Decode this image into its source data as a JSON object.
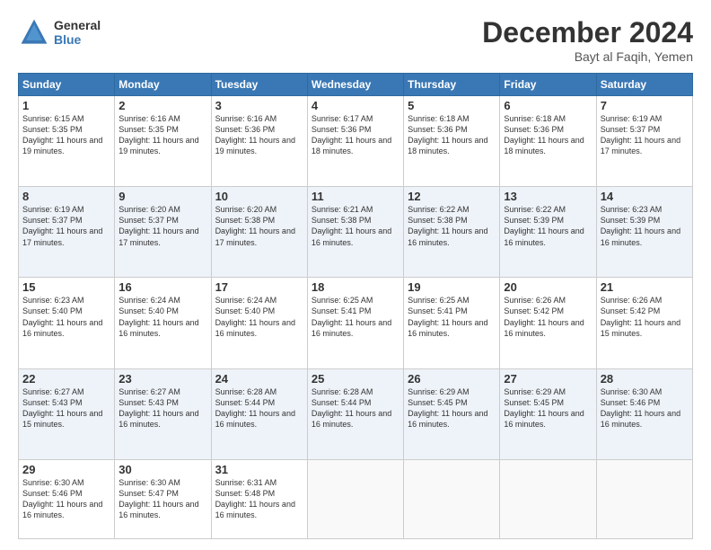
{
  "header": {
    "logo_line1": "General",
    "logo_line2": "Blue",
    "title": "December 2024",
    "subtitle": "Bayt al Faqih, Yemen"
  },
  "days_of_week": [
    "Sunday",
    "Monday",
    "Tuesday",
    "Wednesday",
    "Thursday",
    "Friday",
    "Saturday"
  ],
  "weeks": [
    [
      {
        "day": 1,
        "info": "Sunrise: 6:15 AM\nSunset: 5:35 PM\nDaylight: 11 hours and 19 minutes."
      },
      {
        "day": 2,
        "info": "Sunrise: 6:16 AM\nSunset: 5:35 PM\nDaylight: 11 hours and 19 minutes."
      },
      {
        "day": 3,
        "info": "Sunrise: 6:16 AM\nSunset: 5:36 PM\nDaylight: 11 hours and 19 minutes."
      },
      {
        "day": 4,
        "info": "Sunrise: 6:17 AM\nSunset: 5:36 PM\nDaylight: 11 hours and 18 minutes."
      },
      {
        "day": 5,
        "info": "Sunrise: 6:18 AM\nSunset: 5:36 PM\nDaylight: 11 hours and 18 minutes."
      },
      {
        "day": 6,
        "info": "Sunrise: 6:18 AM\nSunset: 5:36 PM\nDaylight: 11 hours and 18 minutes."
      },
      {
        "day": 7,
        "info": "Sunrise: 6:19 AM\nSunset: 5:37 PM\nDaylight: 11 hours and 17 minutes."
      }
    ],
    [
      {
        "day": 8,
        "info": "Sunrise: 6:19 AM\nSunset: 5:37 PM\nDaylight: 11 hours and 17 minutes."
      },
      {
        "day": 9,
        "info": "Sunrise: 6:20 AM\nSunset: 5:37 PM\nDaylight: 11 hours and 17 minutes."
      },
      {
        "day": 10,
        "info": "Sunrise: 6:20 AM\nSunset: 5:38 PM\nDaylight: 11 hours and 17 minutes."
      },
      {
        "day": 11,
        "info": "Sunrise: 6:21 AM\nSunset: 5:38 PM\nDaylight: 11 hours and 16 minutes."
      },
      {
        "day": 12,
        "info": "Sunrise: 6:22 AM\nSunset: 5:38 PM\nDaylight: 11 hours and 16 minutes."
      },
      {
        "day": 13,
        "info": "Sunrise: 6:22 AM\nSunset: 5:39 PM\nDaylight: 11 hours and 16 minutes."
      },
      {
        "day": 14,
        "info": "Sunrise: 6:23 AM\nSunset: 5:39 PM\nDaylight: 11 hours and 16 minutes."
      }
    ],
    [
      {
        "day": 15,
        "info": "Sunrise: 6:23 AM\nSunset: 5:40 PM\nDaylight: 11 hours and 16 minutes."
      },
      {
        "day": 16,
        "info": "Sunrise: 6:24 AM\nSunset: 5:40 PM\nDaylight: 11 hours and 16 minutes."
      },
      {
        "day": 17,
        "info": "Sunrise: 6:24 AM\nSunset: 5:40 PM\nDaylight: 11 hours and 16 minutes."
      },
      {
        "day": 18,
        "info": "Sunrise: 6:25 AM\nSunset: 5:41 PM\nDaylight: 11 hours and 16 minutes."
      },
      {
        "day": 19,
        "info": "Sunrise: 6:25 AM\nSunset: 5:41 PM\nDaylight: 11 hours and 16 minutes."
      },
      {
        "day": 20,
        "info": "Sunrise: 6:26 AM\nSunset: 5:42 PM\nDaylight: 11 hours and 16 minutes."
      },
      {
        "day": 21,
        "info": "Sunrise: 6:26 AM\nSunset: 5:42 PM\nDaylight: 11 hours and 15 minutes."
      }
    ],
    [
      {
        "day": 22,
        "info": "Sunrise: 6:27 AM\nSunset: 5:43 PM\nDaylight: 11 hours and 15 minutes."
      },
      {
        "day": 23,
        "info": "Sunrise: 6:27 AM\nSunset: 5:43 PM\nDaylight: 11 hours and 16 minutes."
      },
      {
        "day": 24,
        "info": "Sunrise: 6:28 AM\nSunset: 5:44 PM\nDaylight: 11 hours and 16 minutes."
      },
      {
        "day": 25,
        "info": "Sunrise: 6:28 AM\nSunset: 5:44 PM\nDaylight: 11 hours and 16 minutes."
      },
      {
        "day": 26,
        "info": "Sunrise: 6:29 AM\nSunset: 5:45 PM\nDaylight: 11 hours and 16 minutes."
      },
      {
        "day": 27,
        "info": "Sunrise: 6:29 AM\nSunset: 5:45 PM\nDaylight: 11 hours and 16 minutes."
      },
      {
        "day": 28,
        "info": "Sunrise: 6:30 AM\nSunset: 5:46 PM\nDaylight: 11 hours and 16 minutes."
      }
    ],
    [
      {
        "day": 29,
        "info": "Sunrise: 6:30 AM\nSunset: 5:46 PM\nDaylight: 11 hours and 16 minutes."
      },
      {
        "day": 30,
        "info": "Sunrise: 6:30 AM\nSunset: 5:47 PM\nDaylight: 11 hours and 16 minutes."
      },
      {
        "day": 31,
        "info": "Sunrise: 6:31 AM\nSunset: 5:48 PM\nDaylight: 11 hours and 16 minutes."
      },
      null,
      null,
      null,
      null
    ]
  ]
}
